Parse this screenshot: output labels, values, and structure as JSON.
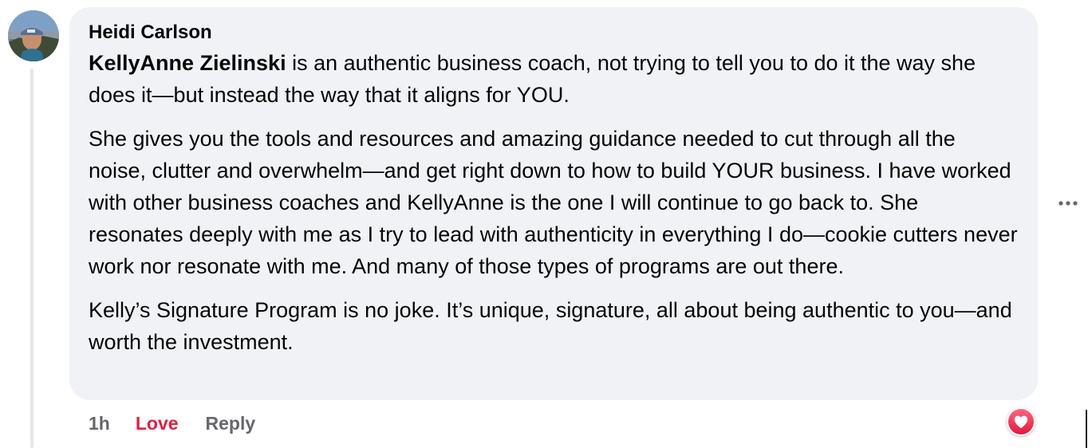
{
  "comment": {
    "author": "Heidi Carlson",
    "mention": "KellyAnne Zielinski",
    "paragraph_1_rest": " is an authentic business coach, not trying to tell you to do it the way she does it—but instead the way that it aligns for YOU.",
    "paragraph_2": "She gives you the tools and resources and amazing guidance needed to cut through all the noise, clutter and overwhelm—and get right down to how to build YOUR business. I have worked with other business coaches and KellyAnne is the one I will continue to go back to. She resonates deeply with me as I try to lead with authenticity in everything I do—cookie cutters never work nor resonate with me. And many of those types of programs are out there.",
    "paragraph_3": "Kelly’s Signature Program is no joke. It’s unique, signature, all about being authentic to you—and worth the investment."
  },
  "actions": {
    "time": "1h",
    "love_label": "Love",
    "reply_label": "Reply"
  },
  "reaction": {
    "icon": "heart-icon",
    "color": "#e41e3f"
  },
  "colors": {
    "bubble": "#f0f2f5",
    "love": "#e41e3f",
    "secondary_text": "#65676b"
  }
}
